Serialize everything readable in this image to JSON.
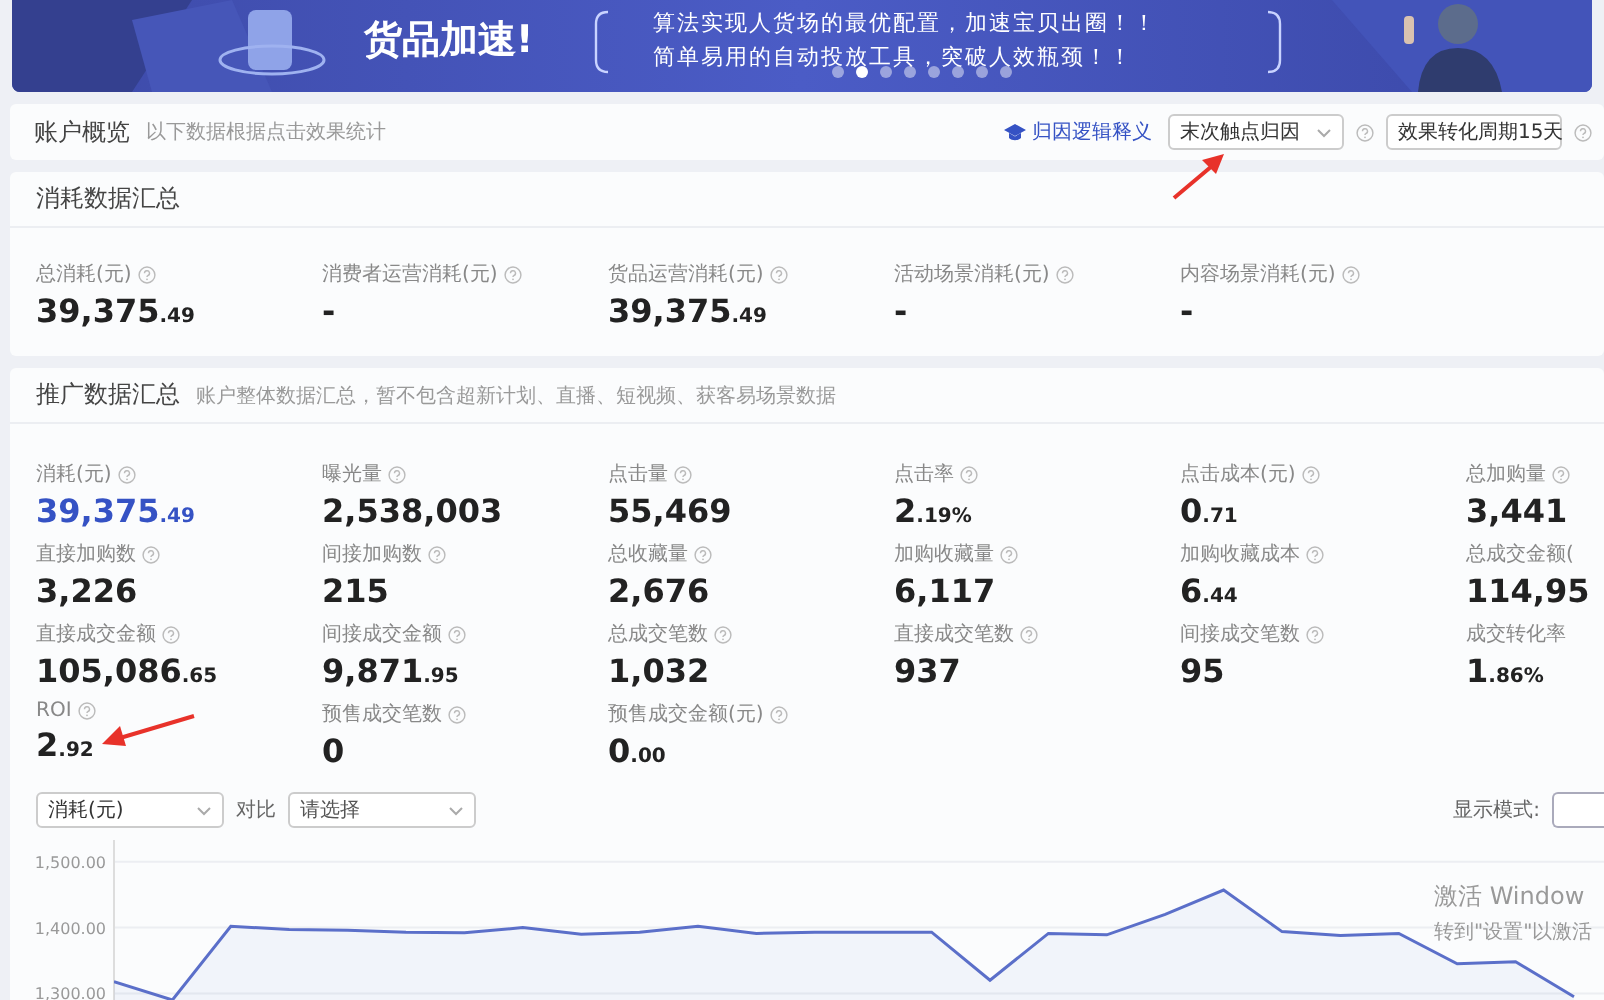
{
  "banner": {
    "title": "货品加速!",
    "lines": [
      "算法实现人货场的最优配置，加速宝贝出圈！！",
      "简单易用的自动投放工具，突破人效瓶颈！！"
    ],
    "dots": [
      {
        "selected": false
      },
      {
        "selected": true
      },
      {
        "selected": false
      },
      {
        "selected": false
      },
      {
        "selected": false
      },
      {
        "selected": false
      },
      {
        "selected": false
      },
      {
        "selected": false
      }
    ]
  },
  "account_overview": {
    "title": "账户概览",
    "hint": "以下数据根据点击效果统计",
    "link": "归因逻辑释义",
    "selects": [
      {
        "value": "末次触点归因"
      },
      {
        "value": "效果转化周期15天"
      }
    ]
  },
  "consumption_summary": {
    "title": "消耗数据汇总",
    "metrics": [
      {
        "label": "总消耗(元)",
        "help": true,
        "main": "39,375",
        "fraction": ".49"
      },
      {
        "label": "消费者运营消耗(元)",
        "help": true,
        "main": "-"
      },
      {
        "label": "货品运营消耗(元)",
        "help": true,
        "main": "39,375",
        "fraction": ".49"
      },
      {
        "label": "活动场景消耗(元)",
        "help": true,
        "main": "-"
      },
      {
        "label": "内容场景消耗(元)",
        "help": true,
        "main": "-"
      }
    ]
  },
  "promotion_summary": {
    "title": "推广数据汇总",
    "hint": "账户整体数据汇总，暂不包含超新计划、直播、短视频、获客易场景数据",
    "metrics": [
      {
        "label": "消耗(元)",
        "help": true,
        "main": "39,375",
        "fraction": ".49",
        "highlight": true
      },
      {
        "label": "曝光量",
        "help": true,
        "main": "2,538,003"
      },
      {
        "label": "点击量",
        "help": true,
        "main": "55,469"
      },
      {
        "label": "点击率",
        "help": true,
        "main": "2",
        "fraction": ".19%"
      },
      {
        "label": "点击成本(元)",
        "help": true,
        "main": "0",
        "fraction": ".71"
      },
      {
        "label": "总加购量",
        "help": true,
        "main": "3,441"
      },
      {
        "label": "直接加购数",
        "help": true,
        "main": "3,226"
      },
      {
        "label": "间接加购数",
        "help": true,
        "main": "215"
      },
      {
        "label": "总收藏量",
        "help": true,
        "main": "2,676"
      },
      {
        "label": "加购收藏量",
        "help": true,
        "main": "6,117"
      },
      {
        "label": "加购收藏成本",
        "help": true,
        "main": "6",
        "fraction": ".44"
      },
      {
        "label": "总成交金额(",
        "help": false,
        "main": "114,95"
      },
      {
        "label": "直接成交金额",
        "help": true,
        "main": "105,086",
        "fraction": ".65"
      },
      {
        "label": "间接成交金额",
        "help": true,
        "main": "9,871",
        "fraction": ".95"
      },
      {
        "label": "总成交笔数",
        "help": true,
        "main": "1,032"
      },
      {
        "label": "直接成交笔数",
        "help": true,
        "main": "937"
      },
      {
        "label": "间接成交笔数",
        "help": true,
        "main": "95"
      },
      {
        "label": "成交转化率",
        "help": false,
        "main": "1",
        "fraction": ".86%"
      },
      {
        "label": "ROI",
        "help": true,
        "main": "2",
        "fraction": ".92"
      },
      {
        "label": "预售成交笔数",
        "help": true,
        "main": "0"
      },
      {
        "label": "预售成交金额(元)",
        "help": true,
        "main": "0",
        "fraction": ".00"
      }
    ],
    "chart_controls": {
      "metric_select": "消耗(元)",
      "compare_label": "对比",
      "compare_placeholder": "请选择",
      "display_mode_label": "显示模式:"
    },
    "chart_data": {
      "type": "area",
      "ylim": [
        1290,
        1533
      ],
      "yticks": [
        {
          "value": 1300,
          "label": "1,300.00"
        },
        {
          "value": 1400,
          "label": "1,400.00"
        },
        {
          "value": 1500,
          "label": "1,500.00"
        }
      ],
      "grid": true,
      "series": [
        {
          "color": "#5b6fc9",
          "values": [
            1318,
            1290,
            1402,
            1397,
            1396,
            1393,
            1392,
            1400,
            1390,
            1393,
            1402,
            1391,
            1393,
            1393,
            1393,
            1320,
            1391,
            1389,
            1420,
            1457,
            1394,
            1388,
            1391,
            1345,
            1348,
            1295
          ]
        }
      ]
    }
  },
  "windows_notice": {
    "title": "激活 Window",
    "subtitle": "转到\"设置\"以激活"
  }
}
